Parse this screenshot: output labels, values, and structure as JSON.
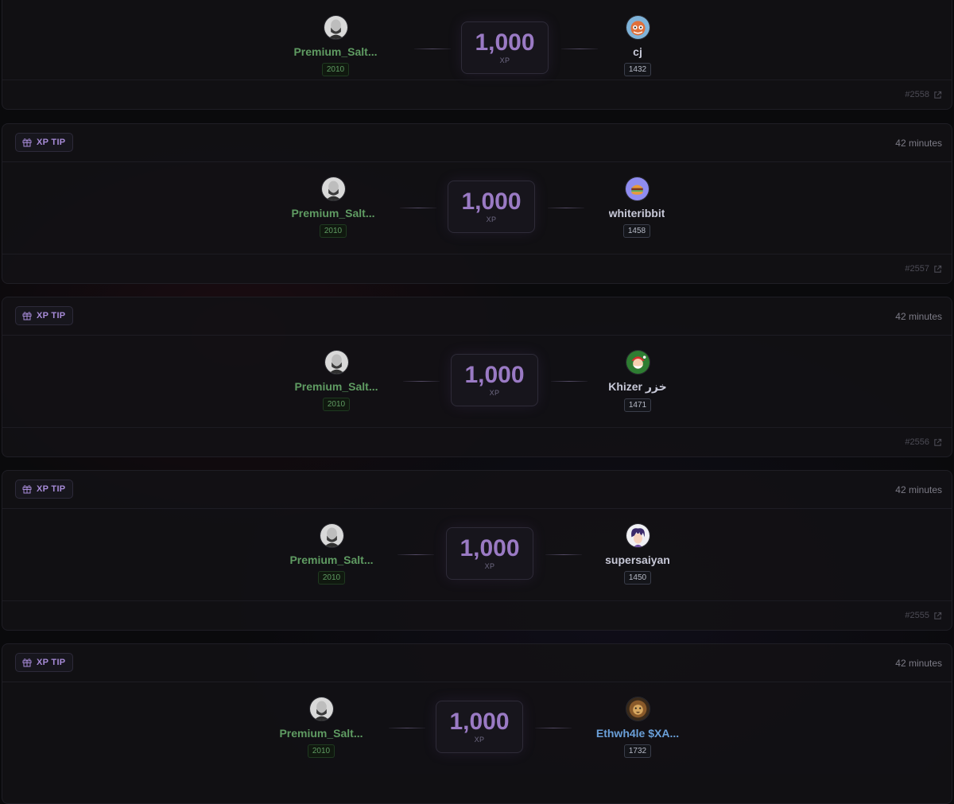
{
  "colors": {
    "background": "#0a0a0c",
    "accent_purple": "#9a7ac4",
    "sender_green": "#5f9b62",
    "link_blue": "#6a9fd8"
  },
  "cards": [
    {
      "tag": "",
      "time": "",
      "sender": {
        "name": "Premium_Salt...",
        "score": "2010",
        "avatar": "bald-man-avatar"
      },
      "amount": "1,000",
      "unit": "XP",
      "receiver": {
        "name": "cj",
        "score": "1432",
        "avatar": "cartoon-fox-avatar"
      },
      "tx_id": "#2558"
    },
    {
      "tag": "XP TIP",
      "time": "42 minutes",
      "sender": {
        "name": "Premium_Salt...",
        "score": "2010",
        "avatar": "bald-man-avatar"
      },
      "amount": "1,000",
      "unit": "XP",
      "receiver": {
        "name": "whiteribbit",
        "score": "1458",
        "avatar": "burger-avatar"
      },
      "tx_id": "#2557"
    },
    {
      "tag": "XP TIP",
      "time": "42 minutes",
      "sender": {
        "name": "Premium_Salt...",
        "score": "2010",
        "avatar": "bald-man-avatar"
      },
      "amount": "1,000",
      "unit": "XP",
      "receiver": {
        "name": "Khizer خزر",
        "score": "1471",
        "avatar": "santa-avatar"
      },
      "tx_id": "#2556"
    },
    {
      "tag": "XP TIP",
      "time": "42 minutes",
      "sender": {
        "name": "Premium_Salt...",
        "score": "2010",
        "avatar": "bald-man-avatar"
      },
      "amount": "1,000",
      "unit": "XP",
      "receiver": {
        "name": "supersaiyan",
        "score": "1450",
        "avatar": "anime-character-avatar"
      },
      "tx_id": "#2555"
    },
    {
      "tag": "XP TIP",
      "time": "42 minutes",
      "sender": {
        "name": "Premium_Salt...",
        "score": "2010",
        "avatar": "bald-man-avatar"
      },
      "amount": "1,000",
      "unit": "XP",
      "receiver": {
        "name": "Ethwh4le $XA...",
        "score": "1732",
        "avatar": "lion-avatar"
      },
      "tx_id": ""
    }
  ]
}
